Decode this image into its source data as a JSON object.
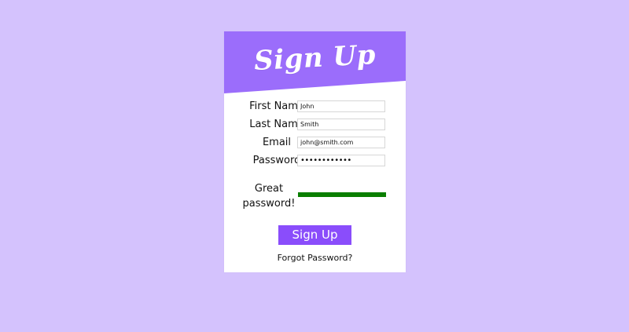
{
  "header": {
    "title": "Sign Up"
  },
  "form": {
    "first_name": {
      "label": "First Name",
      "value": "John"
    },
    "last_name": {
      "label": "Last Name",
      "value": "Smith"
    },
    "email": {
      "label": "Email",
      "value": "john@smith.com"
    },
    "password": {
      "label": "Password",
      "masked_value": "••••••••••••"
    },
    "strength": {
      "text": "Great password!",
      "level": 1.0
    },
    "submit_label": "Sign Up",
    "forgot_label": "Forgot Password?"
  },
  "colors": {
    "page_background": "#d4c2fd",
    "header_background": "#9b6dfb",
    "button_background": "#8a4dfb",
    "strength_good": "#0a7e00"
  }
}
